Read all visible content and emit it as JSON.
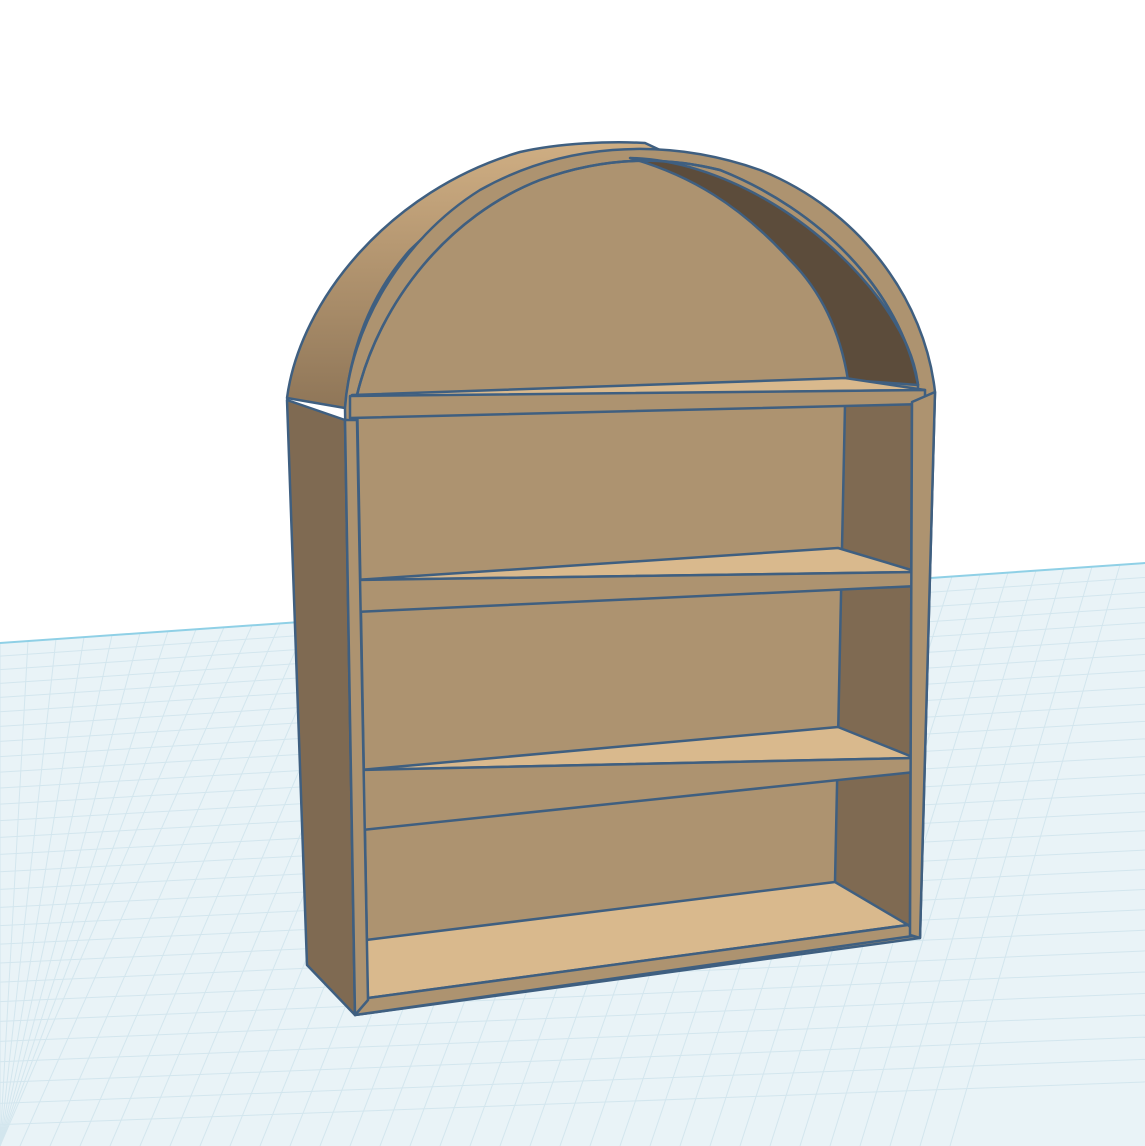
{
  "viewport": {
    "colors": {
      "background": "#ffffff",
      "workplane": "#e9f3f7",
      "workplane_grid": "#d3e6ee",
      "horizon": "#8fd0e6",
      "outline": "#3f5f80",
      "wood_front": "#ad9370",
      "wood_side": "#7f6a52",
      "wood_shadow": "#5c4c3b",
      "wood_top": "#d9b98d",
      "wood_arch": "#b89a74"
    }
  }
}
